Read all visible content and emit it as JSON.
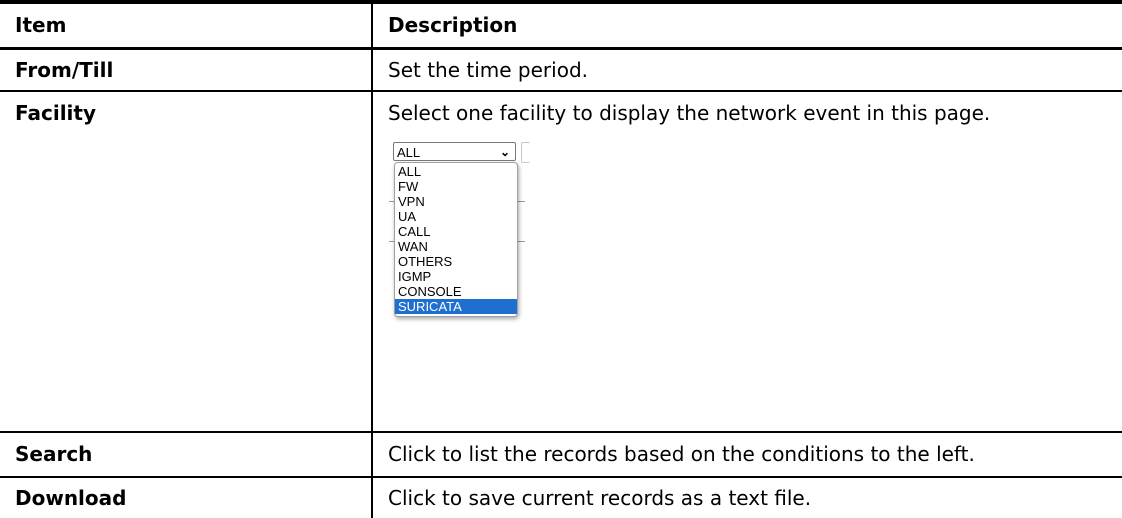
{
  "table": {
    "headers": {
      "item": "Item",
      "description": "Description"
    },
    "rows": [
      {
        "item": "From/Till",
        "description": "Set the time period."
      },
      {
        "item": "Facility",
        "description": "Select one facility to display the network event in this page."
      },
      {
        "item": "Search",
        "description": "Click to list the records based on the conditions to the left."
      },
      {
        "item": "Download",
        "description": "Click to save current records as a text file."
      }
    ]
  },
  "facility_select": {
    "selected_value": "ALL",
    "options": [
      "ALL",
      "FW",
      "VPN",
      "UA",
      "CALL",
      "WAN",
      "OTHERS",
      "IGMP",
      "CONSOLE",
      "SURICATA"
    ],
    "highlighted_option": "SURICATA",
    "highlight_color": "#1f6fd1",
    "chevron_icon": "chevron-down-icon"
  }
}
